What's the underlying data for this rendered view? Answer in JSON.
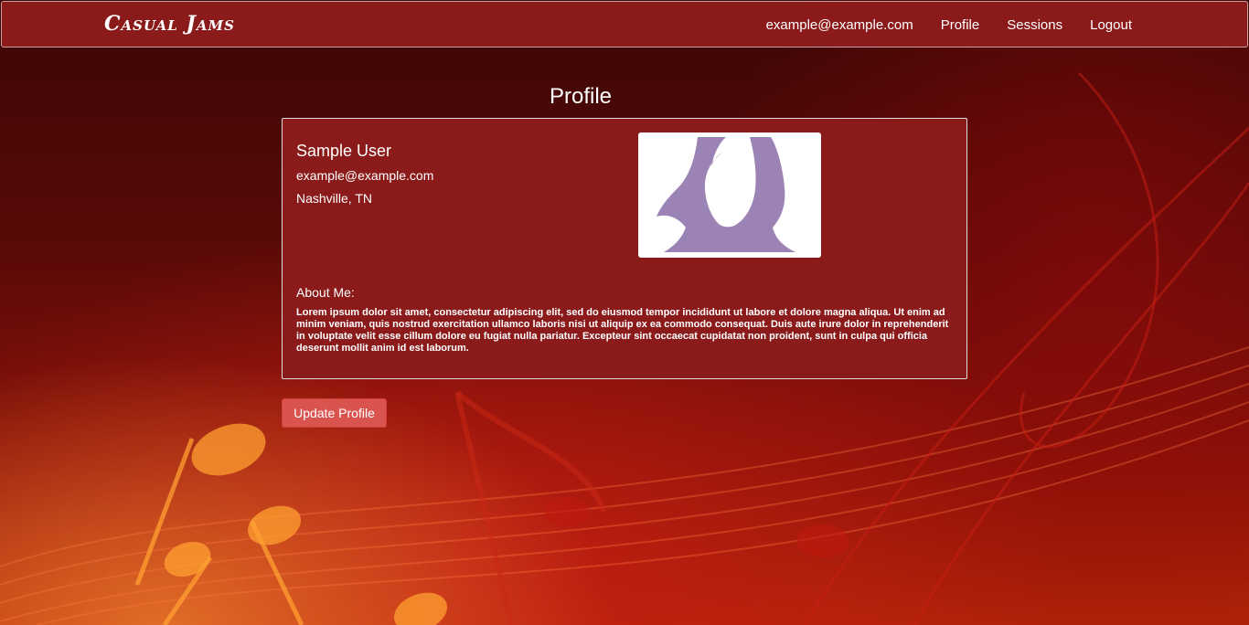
{
  "navbar": {
    "brand": "Casual Jams",
    "links": [
      "example@example.com",
      "Profile",
      "Sessions",
      "Logout"
    ]
  },
  "page": {
    "title": "Profile"
  },
  "profile": {
    "name": "Sample User",
    "email": "example@example.com",
    "location": "Nashville, TN",
    "avatar_icon": "female-avatar-placeholder-icon",
    "about_label": "About Me:",
    "about_text": "Lorem ipsum dolor sit amet, consectetur adipiscing elit, sed do eiusmod tempor incididunt ut labore et dolore magna aliqua. Ut enim ad minim veniam, quis nostrud exercitation ullamco laboris nisi ut aliquip ex ea commodo consequat. Duis aute irure dolor in reprehenderit in voluptate velit esse cillum dolore eu fugiat nulla pariatur. Excepteur sint occaecat cupidatat non proident, sunt in culpa qui officia deserunt mollit anim id est laborum."
  },
  "actions": {
    "update_label": "Update Profile"
  },
  "colors": {
    "navbar": "#8b1a1a",
    "card": "#8b1a1a",
    "button": "#d9534f",
    "avatar": "#9b84b5"
  }
}
